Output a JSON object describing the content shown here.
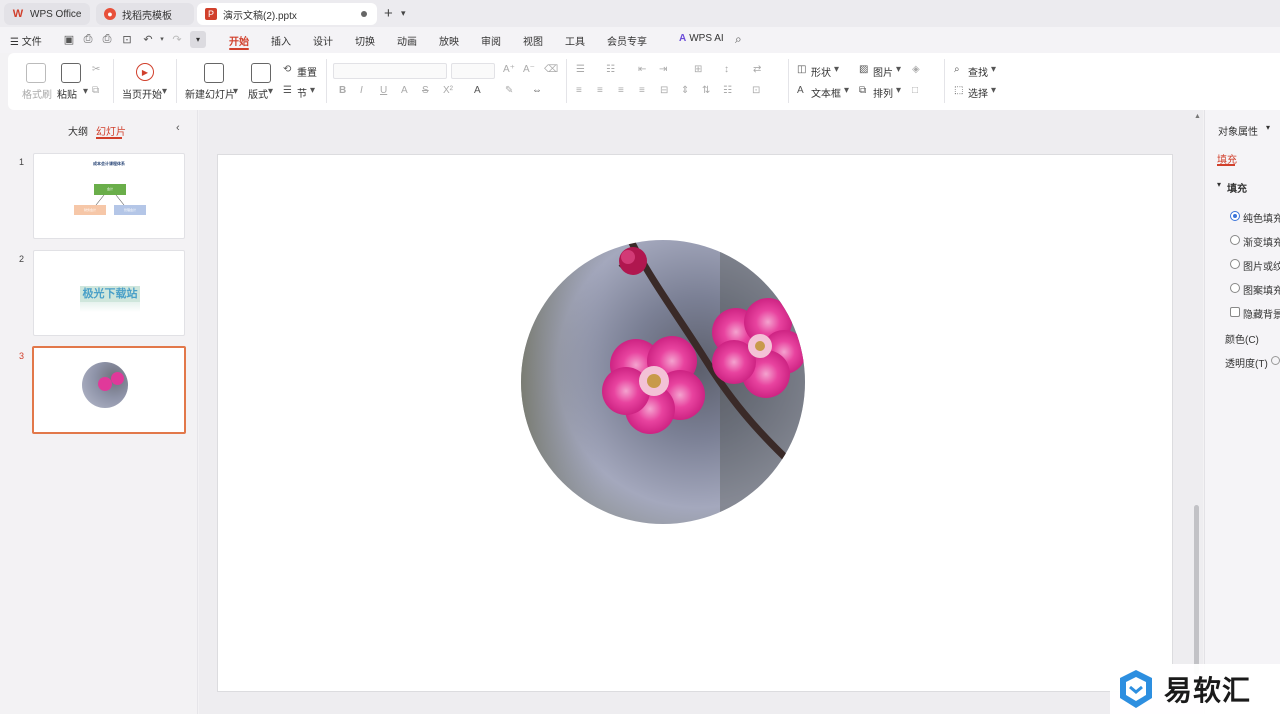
{
  "tabs": [
    {
      "label": "WPS Office"
    },
    {
      "label": "找稻壳模板"
    },
    {
      "label": "演示文稿(2).pptx"
    }
  ],
  "menu": {
    "file": "文件",
    "items": [
      "开始",
      "插入",
      "设计",
      "切换",
      "动画",
      "放映",
      "审阅",
      "视图",
      "工具",
      "会员专享"
    ],
    "active": "开始",
    "wps_ai": "WPS AI"
  },
  "ribbon": {
    "format_painter": "格式刷",
    "paste": "粘贴",
    "play_from_current": "当页开始",
    "new_slide": "新建幻灯片",
    "layout": "版式",
    "reset": "重置",
    "section": "节",
    "shape": "形状",
    "picture": "图片",
    "textbox": "文本框",
    "arrange": "排列",
    "find": "查找",
    "select": "选择"
  },
  "left_panel": {
    "tab_outline": "大纲",
    "tab_slides": "幻灯片",
    "slides": [
      {
        "number": "1",
        "title": "成本会计课程体系",
        "node_top": "会计",
        "node_left": "财务会计",
        "node_right": "管理会计"
      },
      {
        "number": "2",
        "text": "极光下载站"
      },
      {
        "number": "3"
      }
    ],
    "active_slide": 3
  },
  "right_panel": {
    "title": "对象属性",
    "tab_fill": "填充",
    "section_fill": "填充",
    "options": [
      "纯色填充",
      "渐变填充",
      "图片或纹理",
      "图案填充"
    ],
    "selected_option": "纯色填充",
    "hide_bg": "隐藏背景",
    "color_label": "颜色(C)",
    "transparency_label": "透明度(T)"
  },
  "watermark": {
    "text": "易软汇"
  },
  "colors": {
    "accent": "#d1402c",
    "green_node": "#6aae4a",
    "orange_node": "#f6c7a8",
    "blue_node": "#b4c6e7",
    "blossom": "#e0399a"
  }
}
